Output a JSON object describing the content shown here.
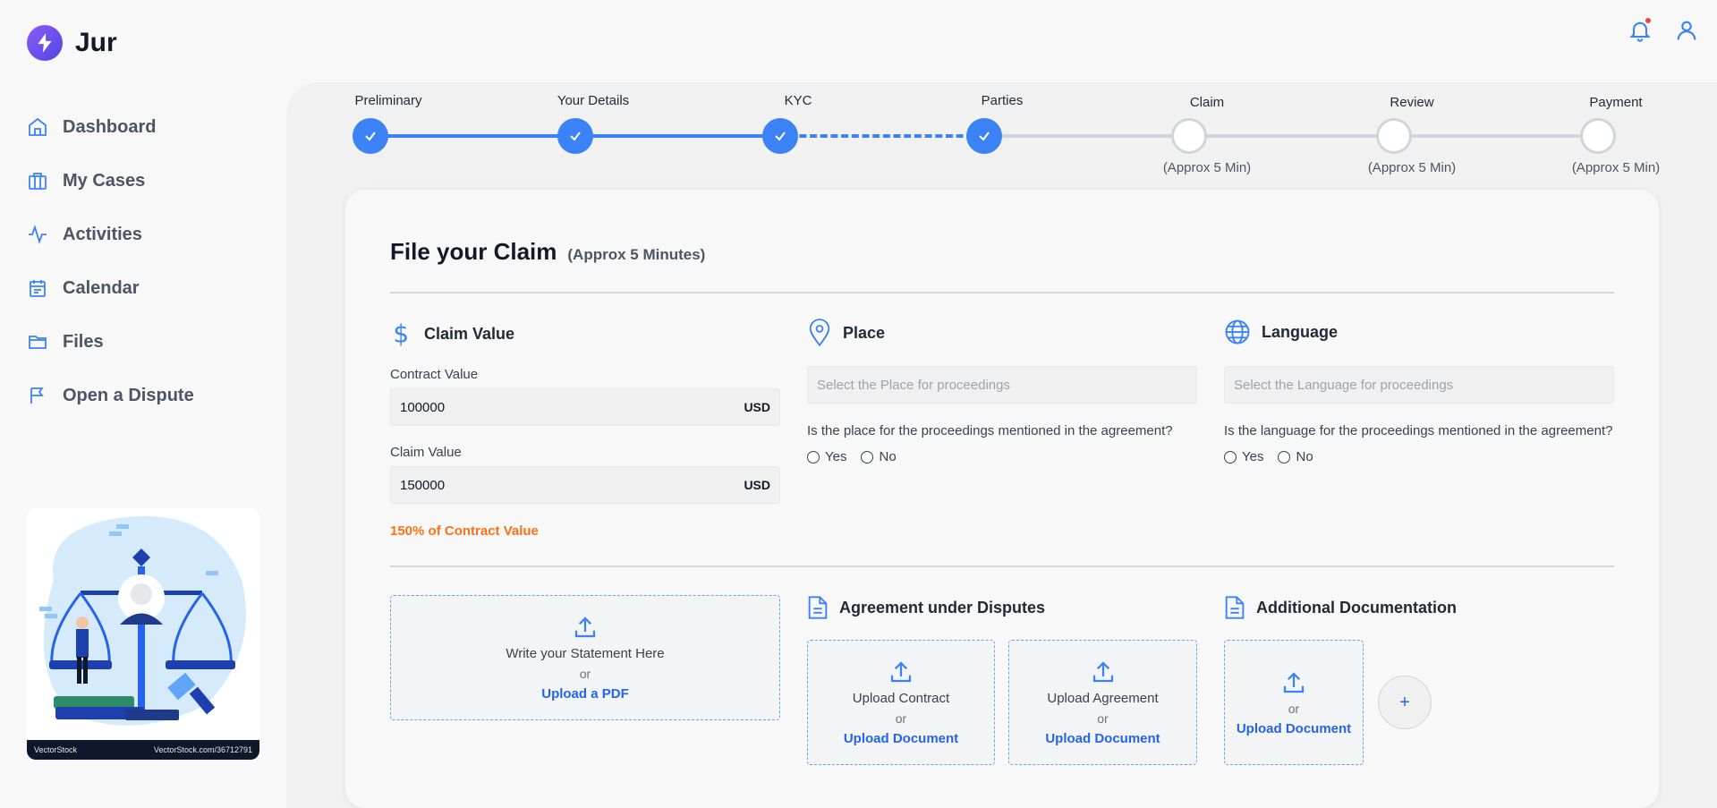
{
  "app": {
    "name": "Jur"
  },
  "sidebar": {
    "items": [
      {
        "label": "Dashboard",
        "icon": "home-icon"
      },
      {
        "label": "My Cases",
        "icon": "briefcase-icon"
      },
      {
        "label": "Activities",
        "icon": "activity-icon"
      },
      {
        "label": "Calendar",
        "icon": "calendar-icon"
      },
      {
        "label": "Files",
        "icon": "folder-icon"
      },
      {
        "label": "Open a Dispute",
        "icon": "flag-icon"
      }
    ],
    "illustration": {
      "brand": "VectorStock",
      "credit": "VectorStock.com/36712791"
    }
  },
  "header": {
    "icons": [
      "bell-icon",
      "user-icon"
    ]
  },
  "stepper": {
    "steps": [
      {
        "label": "Preliminary",
        "status": "done"
      },
      {
        "label": "Your Details",
        "status": "done"
      },
      {
        "label": "KYC",
        "status": "done"
      },
      {
        "label": "Parties",
        "status": "done"
      },
      {
        "label": "Claim",
        "status": "todo",
        "sub": "(Approx 5 Min)"
      },
      {
        "label": "Review",
        "status": "todo",
        "sub": "(Approx 5 Min)"
      },
      {
        "label": "Payment",
        "status": "todo",
        "sub": "(Approx 5 Min)"
      }
    ]
  },
  "form": {
    "title": "File your Claim",
    "subtitle": "(Approx 5 Minutes)",
    "claim_value": {
      "heading": "Claim Value",
      "contract_label": "Contract Value",
      "contract_value": "100000",
      "claim_label": "Claim Value",
      "claim_value": "150000",
      "currency": "USD",
      "hint": "150% of Contract Value"
    },
    "place": {
      "heading": "Place",
      "placeholder": "Select the Place for proceedings",
      "question": "Is the place for the proceedings mentioned in the agreement?",
      "yes": "Yes",
      "no": "No"
    },
    "language": {
      "heading": "Language",
      "placeholder": "Select the Language for proceedings",
      "question": "Is the language for the proceedings mentioned in the agreement?",
      "yes": "Yes",
      "no": "No"
    },
    "statement": {
      "line1": "Write your Statement Here",
      "or": "or",
      "action": "Upload a PDF"
    },
    "agreement": {
      "heading": "Agreement under Disputes",
      "contract": {
        "line1": "Upload Contract",
        "or": "or",
        "action": "Upload Document"
      },
      "agreement": {
        "line1": "Upload Agreement",
        "or": "or",
        "action": "Upload Document"
      }
    },
    "additional": {
      "heading": "Additional Documentation",
      "doc": {
        "or": "or",
        "action": "Upload Document"
      },
      "add": "+"
    }
  },
  "colors": {
    "accent": "#3b82f6",
    "warning": "#f97316",
    "link": "#2563eb"
  }
}
